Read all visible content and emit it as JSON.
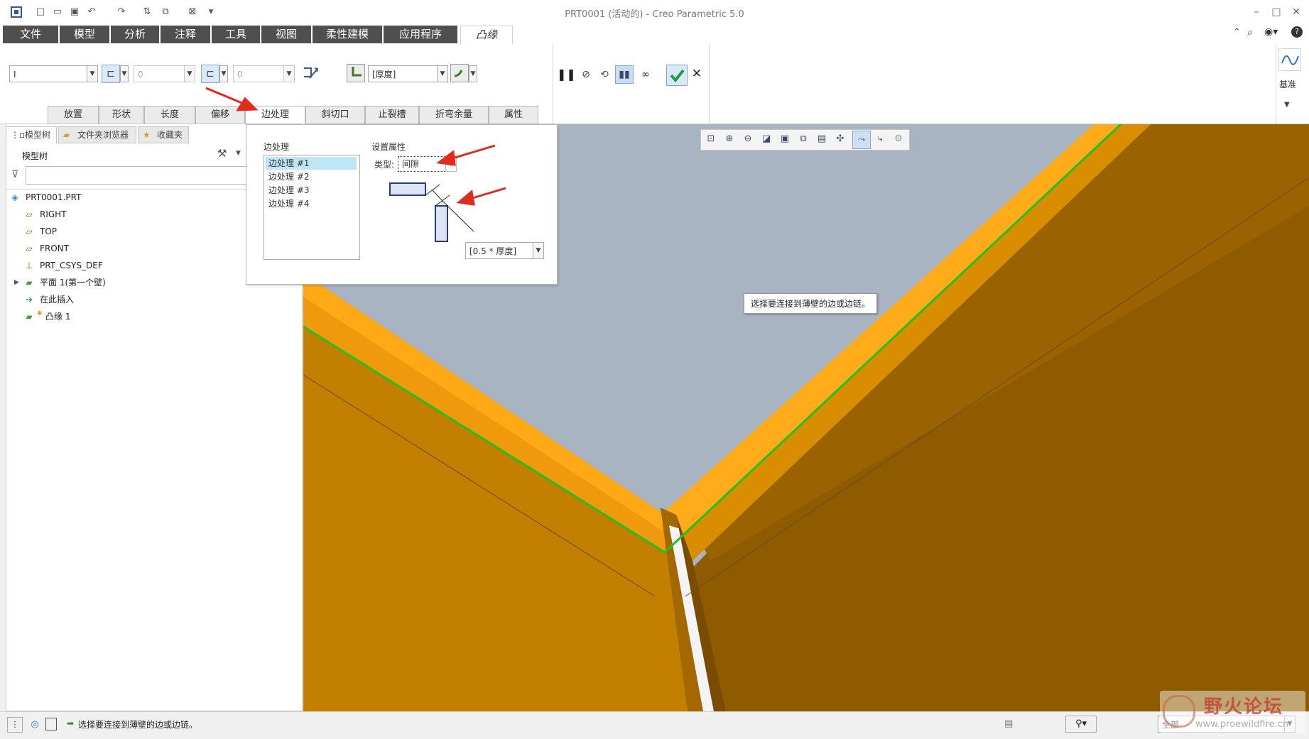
{
  "window": {
    "title": "PRT0001 (活动的) - Creo Parametric 5.0"
  },
  "menu_tabs": [
    "文件",
    "模型",
    "分析",
    "注释",
    "工具",
    "视图",
    "柔性建模",
    "应用程序",
    "凸缘"
  ],
  "ribbon": {
    "shape_value": "I",
    "length1_value": "0",
    "length2_value": "0",
    "thickness_value": "[厚度]",
    "datum_label": "基准"
  },
  "sub_tabs": [
    "放置",
    "形状",
    "长度",
    "偏移",
    "边处理",
    "斜切口",
    "止裂槽",
    "折弯余量",
    "属性"
  ],
  "panel_tabs": [
    "模型树",
    "文件夹浏览器",
    "收藏夹"
  ],
  "model_tree": {
    "header": "模型树",
    "items": [
      {
        "label": "PRT0001.PRT",
        "icon": "part-icon"
      },
      {
        "label": "RIGHT",
        "icon": "datum-plane-icon"
      },
      {
        "label": "TOP",
        "icon": "datum-plane-icon"
      },
      {
        "label": "FRONT",
        "icon": "datum-plane-icon"
      },
      {
        "label": "PRT_CSYS_DEF",
        "icon": "csys-icon"
      },
      {
        "label": "平面 1(第一个壁)",
        "icon": "planar-wall-icon"
      },
      {
        "label": "在此插入",
        "icon": "insert-here-arrow-icon"
      },
      {
        "label": "凸缘 1",
        "icon": "flange-icon"
      }
    ]
  },
  "edge_panel": {
    "title": "边处理",
    "items": [
      "边处理 #1",
      "边处理 #2",
      "边处理 #3",
      "边处理 #4"
    ],
    "props_title": "设置属性",
    "type_label": "类型:",
    "type_value": "间隙",
    "gap_value": "[0.5 * 厚度]"
  },
  "tooltip": "选择要连接到薄壁的边或边链。",
  "status": {
    "message": "选择要连接到薄壁的边或边链。",
    "filter_value": "全部"
  },
  "watermark": {
    "name": "野火论坛",
    "url": "www.proewildfire.cn"
  },
  "colors": {
    "menu_bg": "#4f4f4f",
    "part_orange": "#d08a00",
    "part_highlight": "#ffb01a",
    "edge_green": "#22c021",
    "background": "#a9b4c3",
    "list_selected": "#bfe6f7",
    "arrow_red": "#e02c1c"
  }
}
